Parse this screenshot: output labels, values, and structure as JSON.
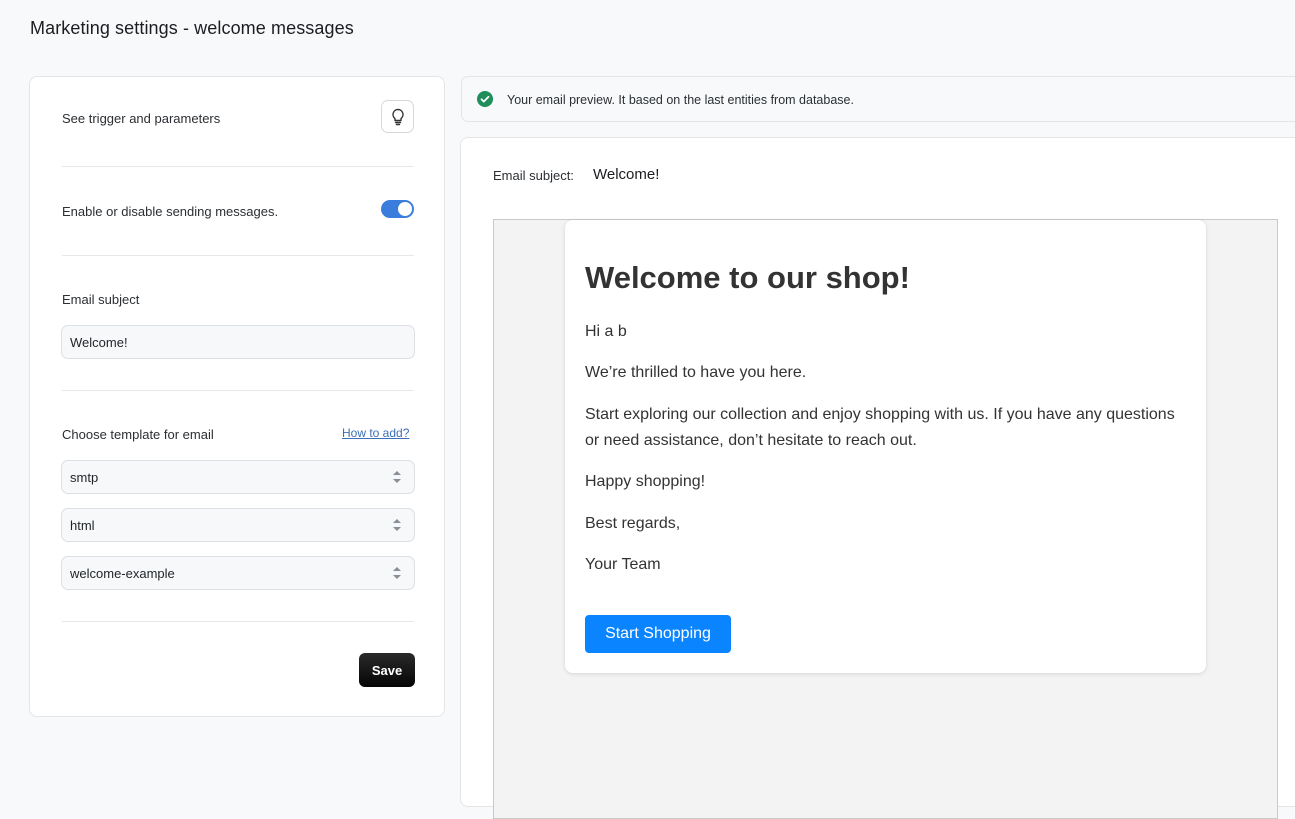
{
  "page": {
    "title": "Marketing settings - welcome messages"
  },
  "settings": {
    "trigger_label": "See trigger and parameters",
    "trigger_icon": "lightbulb-icon",
    "enable_label": "Enable or disable sending messages.",
    "enabled": true,
    "subject_label": "Email subject",
    "subject_value": "Welcome!",
    "template_label": "Choose template for email",
    "how_to_add_link": "How to add?",
    "selects": [
      {
        "value": "smtp"
      },
      {
        "value": "html"
      },
      {
        "value": "welcome-example"
      }
    ],
    "save_label": "Save"
  },
  "notice": {
    "icon": "check-circle-icon",
    "text": "Your email preview. It based on the last entities from database."
  },
  "preview": {
    "subject_label": "Email subject:",
    "subject_value": "Welcome!",
    "email": {
      "heading": "Welcome to our shop!",
      "greeting": "Hi a b",
      "line1": "We’re thrilled to have you here.",
      "line2": "Start exploring our collection and enjoy shopping with us. If you have any questions or need assistance, don’t hesitate to reach out.",
      "line3": "Happy shopping!",
      "line4": "Best regards,",
      "line5": "Your Team",
      "cta_label": "Start Shopping"
    }
  },
  "colors": {
    "toggle_on": "#3b7ddd",
    "success": "#1e8e5a",
    "cta": "#0a84ff",
    "save_button": "#0d0d0d"
  }
}
